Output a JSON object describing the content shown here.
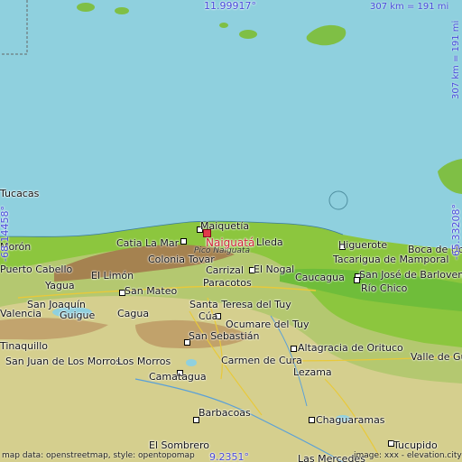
{
  "map": {
    "latitude_top": "11.99917°",
    "latitude_bottom": "9.2351°",
    "longitude_left": "-68.14458°",
    "longitude_right": "-65.33208°",
    "scale_horizontal": "307 km = 191 mi",
    "scale_vertical": "307 km = 191 mi",
    "highlighted_place": "Naiguatá",
    "peak": "Pico Naiguatá",
    "attribution_left": "map data: openstreetmap, style: opentopomap",
    "attribution_right": "image: xxx - elevation.city",
    "colors": {
      "sea": "#8fd0de",
      "lowland": "#8cc63e",
      "hills": "#d8c98a",
      "mountains": "#a2764a",
      "marker": "#e23a4b",
      "coord": "#4a4adb"
    }
  },
  "places": [
    "Maiquetía",
    "Catia La Mar",
    "Colonia Tovar",
    "Carrizal",
    "El Nogal",
    "El Limón",
    "Paracotos",
    "San Mateo",
    "Yagua",
    "San Joaquín",
    "Guigue",
    "Cagua",
    "Valencia",
    "Santa Teresa del Tuy",
    "Cúa",
    "Ocumare del Tuy",
    "San Sebastián",
    "San Juan de Los Morros",
    "Los Morros",
    "Carmen de Cura",
    "Camatagua",
    "Lezama",
    "Barbacoas",
    "El Sombrero",
    "Chaguaramas",
    "Tucupido",
    "Las Mercedes",
    "Higuerote",
    "Tacarigua de Mamporal",
    "San José de Barlovento",
    "Caucagua",
    "Río Chico",
    "Altagracia de Orituco",
    "Valle de Guanape",
    "Puerto Cabello",
    "Tucacas",
    "Morón",
    "Tinaquillo",
    "Boca de Uchire",
    "Lleda"
  ]
}
